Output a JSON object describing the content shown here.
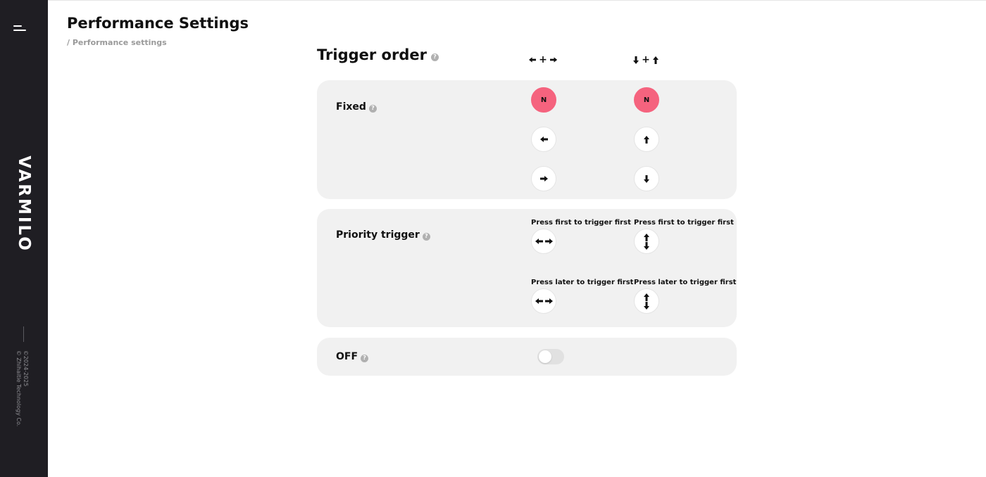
{
  "sidebar": {
    "logo_text": "VARMILO",
    "copyright_line1": "©2024-2025",
    "copyright_line2": "© Zhihaitie Technology Co."
  },
  "header": {
    "title": "Performance Settings",
    "breadcrumb": "/ Performance settings"
  },
  "trigger_order": {
    "title": "Trigger order",
    "help_symbol": "?",
    "plus_symbol": "+",
    "columns": [
      {
        "name": "horizontal",
        "icons": [
          "arrow-left-icon",
          "arrow-right-icon"
        ]
      },
      {
        "name": "vertical",
        "icons": [
          "arrow-down-icon",
          "arrow-up-icon"
        ]
      }
    ]
  },
  "fixed": {
    "label": "Fixed",
    "neutral_label": "N",
    "active_color": "#f5637e"
  },
  "priority": {
    "label": "Priority trigger",
    "press_first_label": "Press first to trigger first",
    "press_later_label": "Press later to trigger first"
  },
  "off": {
    "label": "OFF",
    "enabled": false
  }
}
